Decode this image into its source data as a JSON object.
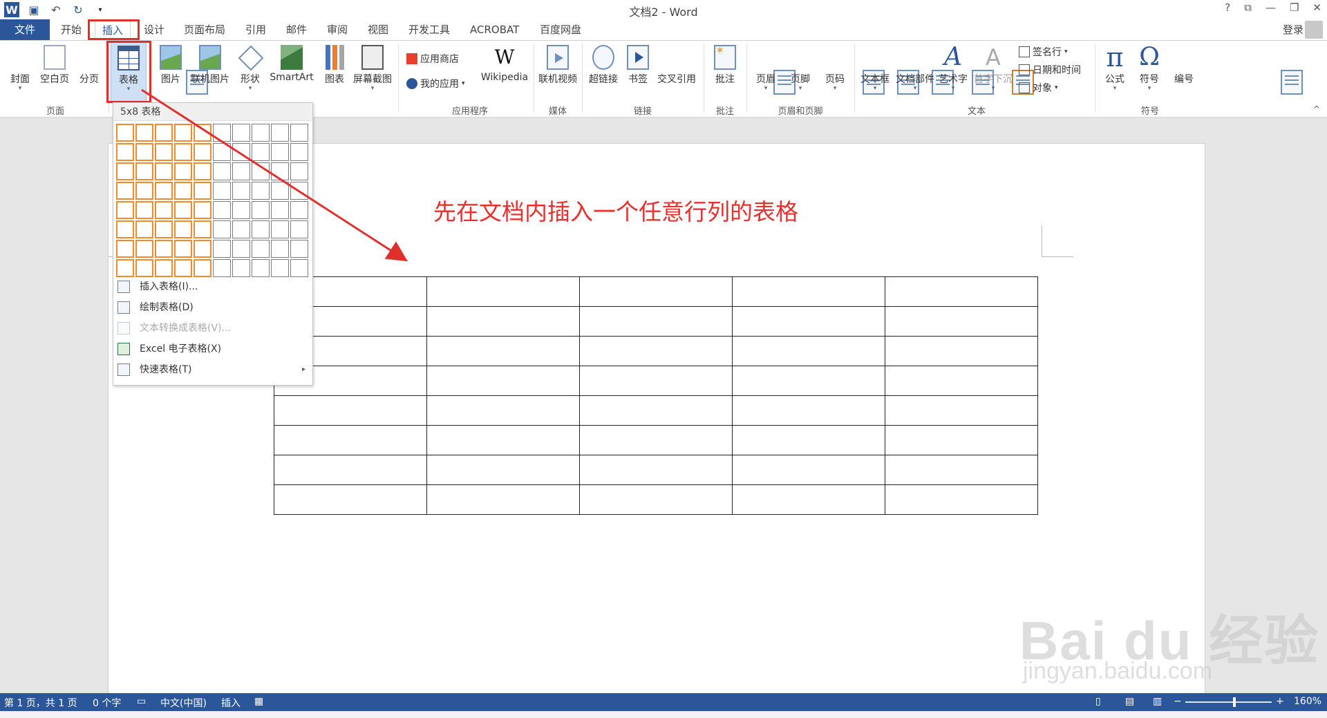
{
  "window": {
    "title": "文档2 - Word",
    "help": "?",
    "controls": [
      "⧉",
      "—",
      "❐",
      "✕"
    ]
  },
  "tabs": {
    "file": "文件",
    "items": [
      "开始",
      "插入",
      "设计",
      "页面布局",
      "引用",
      "邮件",
      "审阅",
      "视图",
      "开发工具",
      "ACROBAT",
      "百度网盘"
    ],
    "active": "插入",
    "login": "登录"
  },
  "ribbon": {
    "pages": {
      "cover": "封面",
      "blank": "空白页",
      "break": "分页",
      "group": "页面"
    },
    "tables": {
      "table": "表格"
    },
    "illustrations": {
      "picture": "图片",
      "online_picture": "联机图片",
      "shapes": "形状",
      "smartart": "SmartArt",
      "chart": "图表",
      "screenshot": "屏幕截图"
    },
    "apps": {
      "store": "应用商店",
      "my_apps": "我的应用",
      "wikipedia": "Wikipedia",
      "wiki_glyph": "W",
      "group": "应用程序"
    },
    "media": {
      "online_video": "联机视频",
      "group": "媒体"
    },
    "links": {
      "hyperlink": "超链接",
      "bookmark": "书签",
      "crossref": "交叉引用",
      "group": "链接"
    },
    "comments": {
      "comment": "批注",
      "group": "批注"
    },
    "header_footer": {
      "header": "页眉",
      "footer": "页脚",
      "page_number": "页码",
      "group": "页眉和页脚"
    },
    "text": {
      "textbox": "文本框",
      "quickparts": "文档部件",
      "wordart": "艺术字",
      "dropcap": "首字下沉",
      "signature": "签名行",
      "datetime": "日期和时间",
      "object": "对象",
      "group": "文本",
      "wordart_glyph": "A",
      "dropcap_glyph": "A"
    },
    "symbols": {
      "equation": "公式",
      "symbol": "符号",
      "numbering": "编号",
      "group": "符号",
      "pi_glyph": "π",
      "omega_glyph": "Ω"
    },
    "collapse_glyph": "^"
  },
  "dropdown": {
    "header": "5x8 表格",
    "grid_cols": 10,
    "grid_rows": 8,
    "selected_cols": 5,
    "selected_rows": 8,
    "items": [
      {
        "label": "插入表格(I)...",
        "disabled": false
      },
      {
        "label": "绘制表格(D)",
        "disabled": false
      },
      {
        "label": "文本转换成表格(V)...",
        "disabled": true
      },
      {
        "label": "Excel 电子表格(X)",
        "disabled": false
      },
      {
        "label": "快速表格(T)",
        "disabled": false,
        "submenu": true
      }
    ],
    "submenu_glyph": "▸"
  },
  "document": {
    "annotation": "先在文档内插入一个任意行列的表格",
    "table_rows": 8,
    "table_cols": 5
  },
  "statusbar": {
    "page": "第 1 页，共 1 页",
    "words": "0 个字",
    "language": "中文(中国)",
    "mode": "插入",
    "zoom": "160%",
    "zoom_minus": "−",
    "zoom_plus": "+"
  },
  "watermark": {
    "line1": "Bai du 经验",
    "line2": "jingyan.baidu.com"
  },
  "colors": {
    "accent": "#2b579a",
    "annotation": "#e8302c",
    "selection": "#f08a2c"
  }
}
